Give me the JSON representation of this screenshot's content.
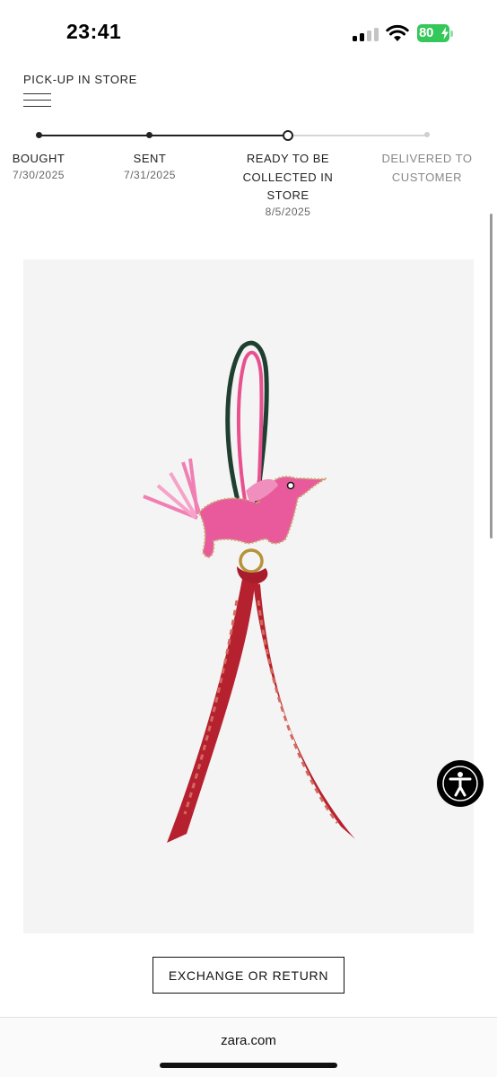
{
  "status_bar": {
    "time": "23:41",
    "battery_level": "80",
    "battery_charging": true,
    "battery_color": "#34c759",
    "signal_bars_active": 2,
    "icons": [
      "cellular-signal-icon",
      "wifi-icon",
      "battery-icon"
    ]
  },
  "header": {
    "title": "PICK-UP IN STORE",
    "menu_icon": "hamburger-menu-icon"
  },
  "timeline": {
    "current_step_index": 2,
    "steps": [
      {
        "lines": [
          "BOUGHT"
        ],
        "date": "7/30/2025",
        "state": "done"
      },
      {
        "lines": [
          "SENT"
        ],
        "date": "7/31/2025",
        "state": "done"
      },
      {
        "lines": [
          "READY TO BE",
          "COLLECTED IN",
          "STORE"
        ],
        "date": "8/5/2025",
        "state": "current"
      },
      {
        "lines": [
          "DELIVERED TO",
          "CUSTOMER"
        ],
        "date": "",
        "state": "pending"
      }
    ]
  },
  "product": {
    "image_icon": "product-photo"
  },
  "actions": {
    "exchange_label": "EXCHANGE OR RETURN",
    "accessibility_icon": "accessibility-icon"
  },
  "browser": {
    "url": "zara.com"
  }
}
